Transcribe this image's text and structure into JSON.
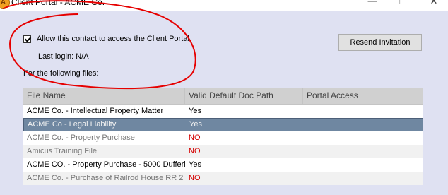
{
  "window": {
    "title": "Client Portal - ACME Co.",
    "app_icon_letter": "A",
    "minimize_glyph": "—",
    "maximize_glyph": "☐",
    "close_glyph": "✕"
  },
  "access": {
    "allow_label": "Allow this contact to access the Client Portal",
    "allow_checked": true,
    "last_login": "Last login: N/A",
    "files_label": "For the following files:"
  },
  "resend_button": "Resend Invitation",
  "grid": {
    "columns": [
      "File Name",
      "Valid Default Doc Path",
      "Portal Access"
    ],
    "rows": [
      {
        "file": "ACME Co. - Intellectual Property Matter",
        "valid": "Yes",
        "access": true,
        "style": "black"
      },
      {
        "file": "ACME Co - Legal Liability",
        "valid": "Yes",
        "access": false,
        "style": "selected"
      },
      {
        "file": "ACME Co. - Property Purchase",
        "valid": "NO",
        "access": false,
        "style": "grey"
      },
      {
        "file": "Amicus Training File",
        "valid": "NO",
        "access": false,
        "style": "grey"
      },
      {
        "file": "ACME CO. - Property Purchase - 5000 Dufferi",
        "valid": "Yes",
        "access": false,
        "style": "black"
      },
      {
        "file": "ACME Co. - Purchase of Railrod House RR 2",
        "valid": "NO",
        "access": false,
        "style": "grey"
      }
    ]
  },
  "colors": {
    "background": "#dfe1f2",
    "header": "#d0d0d0",
    "selected_row": "#6f87a1",
    "no_text": "#d40000",
    "annotation": "#e60000"
  }
}
